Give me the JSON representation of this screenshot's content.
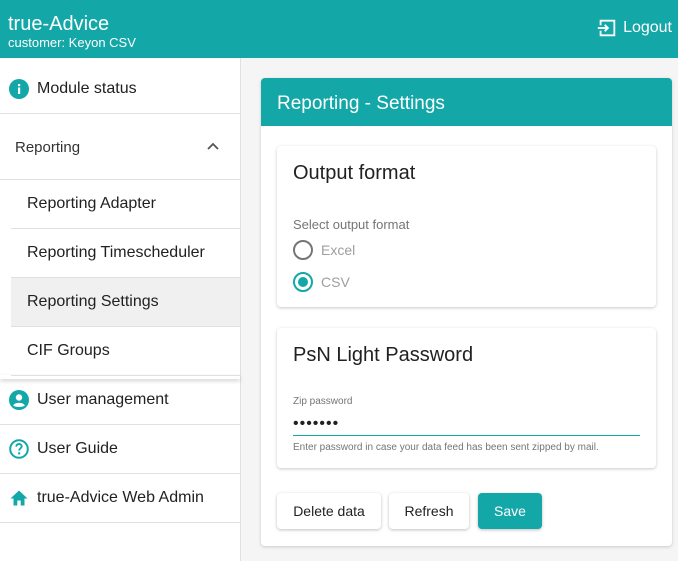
{
  "app": {
    "title": "true-Advice",
    "customer": "customer: Keyon CSV",
    "logout_label": "Logout"
  },
  "colors": {
    "accent": "#13a7a7"
  },
  "sidebar": {
    "module_status": {
      "label": "Module status",
      "icon": "info-icon"
    },
    "reporting": {
      "label": "Reporting",
      "expanded": true,
      "items": [
        {
          "label": "Reporting Adapter"
        },
        {
          "label": "Reporting Timescheduler"
        },
        {
          "label": "Reporting Settings",
          "active": true
        },
        {
          "label": "CIF Groups"
        }
      ]
    },
    "user_management": {
      "label": "User management",
      "icon": "account-circle-icon"
    },
    "user_guide": {
      "label": "User Guide",
      "icon": "help-icon"
    },
    "web_admin": {
      "label": "true-Advice Web Admin",
      "icon": "home-icon"
    }
  },
  "main": {
    "title": "Reporting - Settings",
    "output_format": {
      "title": "Output format",
      "select_label": "Select output format",
      "options": [
        {
          "label": "Excel",
          "checked": false
        },
        {
          "label": "CSV",
          "checked": true
        }
      ]
    },
    "psn": {
      "title": "PsN Light Password",
      "field_label": "Zip password",
      "value": "•••••••",
      "hint": "Enter password in case your data feed has been sent zipped by mail."
    },
    "buttons": {
      "delete": "Delete data",
      "refresh": "Refresh",
      "save": "Save"
    }
  }
}
